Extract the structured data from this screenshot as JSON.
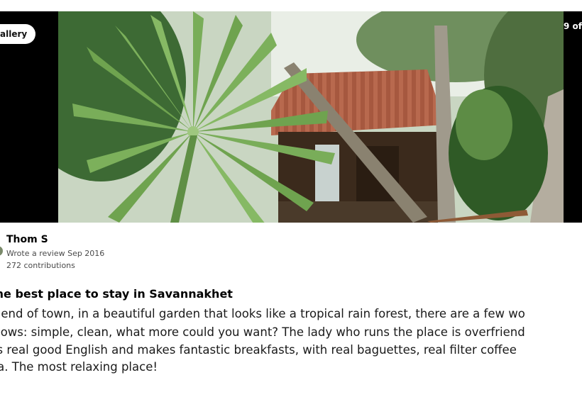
{
  "gallery": {
    "button_label": "allery",
    "counter": "9 of"
  },
  "reviewer": {
    "name": "Thom S",
    "meta": "Wrote a review Sep 2016",
    "contributions": "272 contributions"
  },
  "review": {
    "title": "the best place to stay in Savannakhet",
    "lines": [
      "e end of town, in a beautiful garden that looks like a tropical rain forest, there are a few wo",
      "alows: simple, clean, what more could you want? The lady who runs the place is overfriend",
      "ks real good English and makes fantastic breakfasts, with real baguettes, real filter coffee",
      "ea. The most relaxing place!"
    ]
  },
  "colors": {
    "gallery_bg": "#000000",
    "text_primary": "#1a1a1a",
    "text_secondary": "#4a4a4a"
  }
}
